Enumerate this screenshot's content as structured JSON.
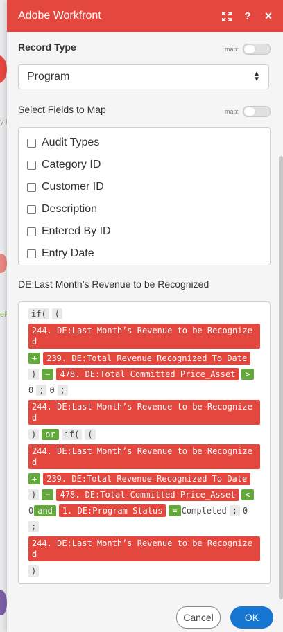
{
  "header": {
    "title": "Adobe Workfront",
    "icons": [
      "expand-icon",
      "help-icon",
      "close-icon"
    ],
    "help_label": "?",
    "close_label": "×",
    "color": "#e4473e"
  },
  "record_type": {
    "label": "Record Type",
    "map_label": "map:",
    "selected": "Program"
  },
  "fields": {
    "label": "Select Fields to Map",
    "map_label": "map:",
    "items": [
      "Audit Types",
      "Category ID",
      "Customer ID",
      "Description",
      "Entered By ID",
      "Entry Date"
    ]
  },
  "formula": {
    "label": "DE:Last Month’s Revenue to be Recognized",
    "t_if1": "if(",
    "t_paren1": "(",
    "t_f244a": "244. DE:Last Month’s Revenue to be Recognized",
    "t_plus1": "+",
    "t_f239a": "239. DE:Total Revenue Recognized To Date",
    "t_close1": ")",
    "t_minus1": "−",
    "t_f478a": "478. DE:Total Committed Price_Asset",
    "t_gt": ">",
    "t_zero1": "0",
    "t_semi1": ";",
    "t_zero2": "0",
    "t_semi2": ";",
    "t_f244b": "244. DE:Last Month’s Revenue to be Recognized",
    "t_close2": ")",
    "t_or": "or",
    "t_if2": "if(",
    "t_paren2": "(",
    "t_f244c": "244. DE:Last Month’s Revenue to be Recognized",
    "t_plus2": "+",
    "t_f239b": "239. DE:Total Revenue Recognized To Date",
    "t_close3": ")",
    "t_minus2": "−",
    "t_f478b": "478. DE:Total Committed Price_Asset",
    "t_lt": "<",
    "t_zero3": "0",
    "t_and": "and",
    "t_f1": "1. DE:Program Status",
    "t_eq": "=",
    "t_completed": "Completed",
    "t_semi3": ";",
    "t_zero4": "0",
    "t_semi4": ";",
    "t_f244d": "244. DE:Last Month’s Revenue to be Recognized",
    "t_close4": ")"
  },
  "footer": {
    "cancel_label": "Cancel",
    "ok_label": "OK",
    "ok_color": "#1676d2"
  }
}
